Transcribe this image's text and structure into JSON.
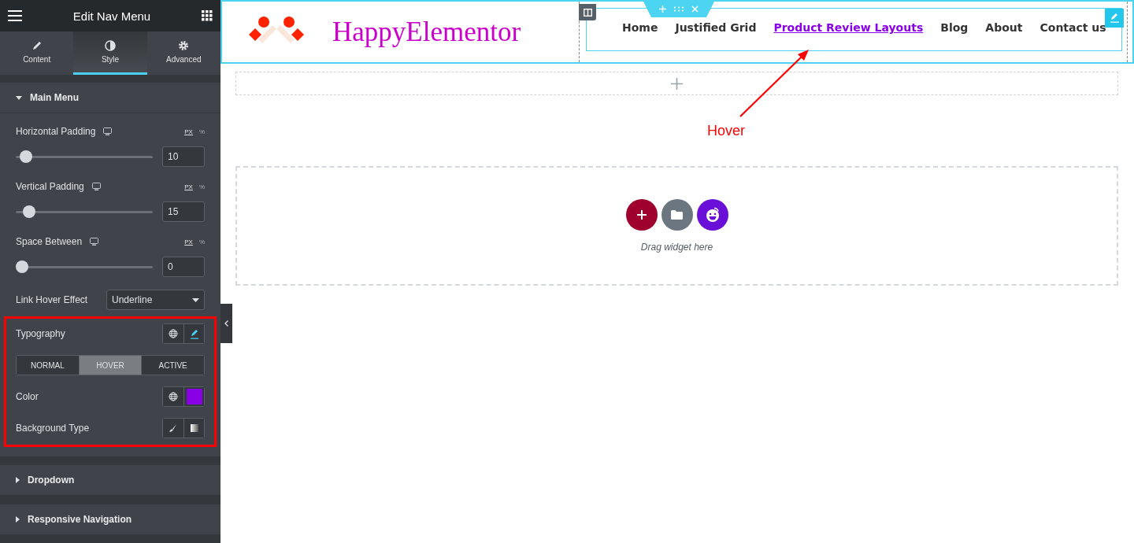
{
  "panel": {
    "title": "Edit Nav Menu",
    "tabs": [
      {
        "label": "Content",
        "kind": "pencil",
        "selected": false
      },
      {
        "label": "Style",
        "kind": "contrast",
        "selected": true
      },
      {
        "label": "Advanced",
        "kind": "gear",
        "selected": false
      }
    ],
    "sections": [
      {
        "title": "Main Menu",
        "expanded": true,
        "controls": [
          {
            "kind": "slider",
            "label": "Horizontal Padding",
            "units": [
              {
                "label": "PX",
                "selected": true
              },
              {
                "label": "%",
                "selected": false
              }
            ],
            "level": 0.03,
            "value": "10"
          },
          {
            "kind": "slider",
            "label": "Vertical Padding",
            "units": [
              {
                "label": "PX",
                "selected": true
              },
              {
                "label": "%",
                "selected": false
              }
            ],
            "level": 0.05,
            "value": "15"
          },
          {
            "kind": "slider",
            "label": "Space Between",
            "units": [
              {
                "label": "PX",
                "selected": true
              },
              {
                "label": "%",
                "selected": false
              }
            ],
            "level": 0,
            "value": "0"
          },
          {
            "kind": "select",
            "label": "Link Hover Effect",
            "value": "Underline"
          }
        ],
        "highlighted": [
          {
            "kind": "typography",
            "label": "Typography"
          },
          {
            "kind": "states",
            "states": [
              {
                "label": "NORMAL",
                "selected": false
              },
              {
                "label": "HOVER",
                "selected": true
              },
              {
                "label": "ACTIVE",
                "selected": false
              }
            ]
          },
          {
            "kind": "color",
            "label": "Color",
            "color": "#8a00e6"
          },
          {
            "kind": "background",
            "label": "Background Type"
          }
        ]
      },
      {
        "title": "Dropdown",
        "expanded": false
      },
      {
        "title": "Responsive Navigation",
        "expanded": false
      }
    ]
  },
  "canvas": {
    "logo_text": "HappyElementor",
    "nav": [
      {
        "label": "Home",
        "hovered": false
      },
      {
        "label": "Justified Grid",
        "hovered": false
      },
      {
        "label": "Product Review Layouts",
        "hovered": true
      },
      {
        "label": "Blog",
        "hovered": false
      },
      {
        "label": "About",
        "hovered": false
      },
      {
        "label": "Contact us",
        "hovered": false
      }
    ],
    "drop_hint": "Drag widget here",
    "annotation": {
      "label": "Hover"
    }
  }
}
